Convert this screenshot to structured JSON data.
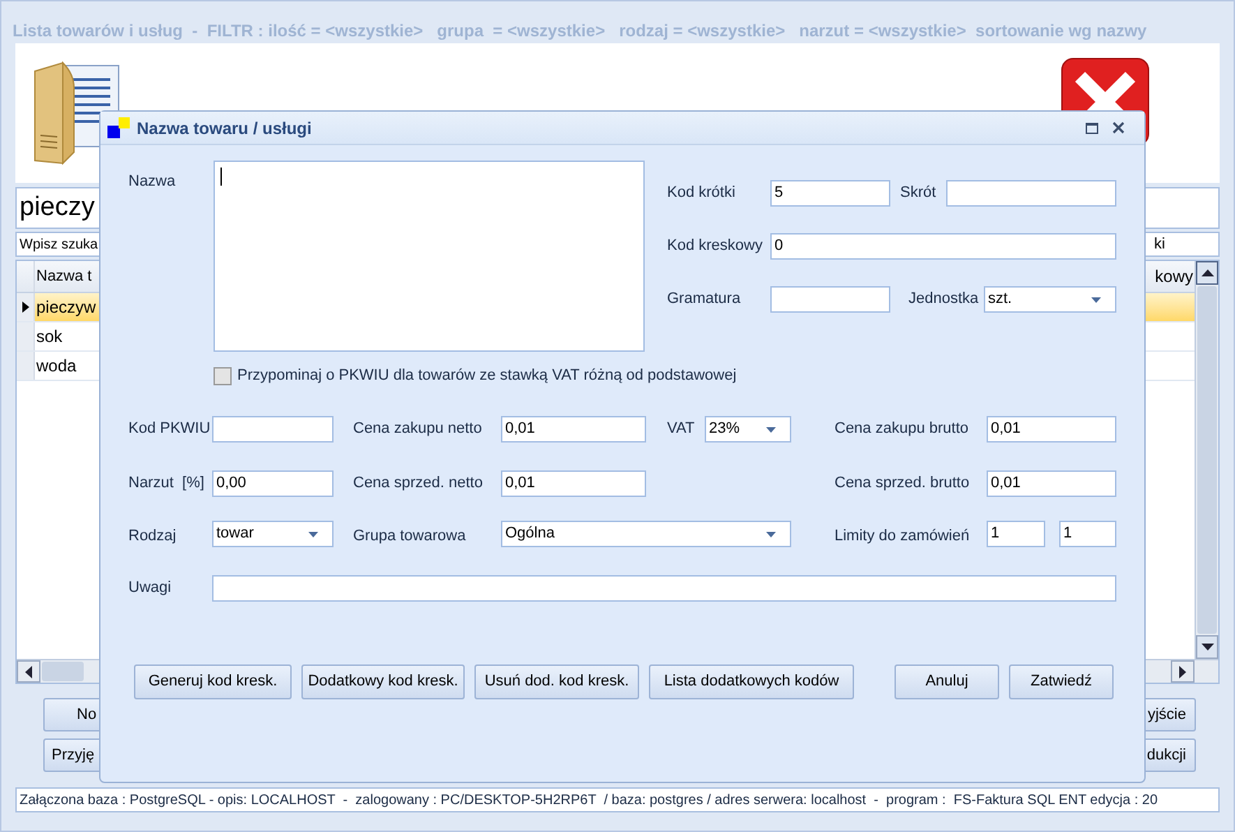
{
  "window": {
    "title": "Lista towarów i usług  -  FILTR : ilość = <wszystkie>   grupa  = <wszystkie>   rodzaj = <wszystkie>   narzut = <wszystkie>  sortowanie wg nazwy"
  },
  "search": {
    "value": "pieczy",
    "hint": "Wpisz szuka",
    "hint_right": "ki"
  },
  "table": {
    "columns": [
      "Nazwa t",
      "kowy"
    ],
    "rows": [
      {
        "name": "pieczyw",
        "selected": true
      },
      {
        "name": "sok",
        "selected": false
      },
      {
        "name": "woda",
        "selected": false
      }
    ]
  },
  "buttons_left": [
    "No",
    "Przyję"
  ],
  "buttons_right": [
    "yjście",
    "dukcji"
  ],
  "status_bar": "Załączona baza : PostgreSQL - opis: LOCALHOST  -  zalogowany : PC/DESKTOP-5H2RP6T  / baza: postgres / adres serwera: localhost  -  program :  FS-Faktura SQL ENT edycja : 20",
  "dialog": {
    "title": "Nazwa towaru / usługi",
    "name": {
      "label": "Nazwa"
    },
    "short_code": {
      "label": "Kod krótki",
      "value": "5"
    },
    "abbreviation": {
      "label": "Skrót"
    },
    "barcode": {
      "label": "Kod kreskowy",
      "value": "0"
    },
    "grammage": {
      "label": "Gramatura"
    },
    "unit": {
      "label": "Jednostka",
      "value": "szt."
    },
    "pkwiu_reminder": {
      "label": "Przypominaj o PKWIU dla towarów ze stawką VAT różną od podstawowej",
      "checked": false
    },
    "pkwiu": {
      "label": "Kod PKWIU"
    },
    "purchase_net": {
      "label": "Cena zakupu netto",
      "value": "0,01"
    },
    "vat": {
      "label": "VAT",
      "value": "23%"
    },
    "purchase_gross": {
      "label": "Cena zakupu brutto",
      "value": "0,01"
    },
    "markup": {
      "label": "Narzut  [%]",
      "value": "0,00"
    },
    "sale_net": {
      "label": "Cena sprzed. netto",
      "value": "0,01"
    },
    "sale_gross": {
      "label": "Cena sprzed. brutto",
      "value": "0,01"
    },
    "kind": {
      "label": "Rodzaj",
      "value": "towar"
    },
    "group": {
      "label": "Grupa towarowa",
      "value": "Ogólna"
    },
    "order_limits": {
      "label": "Limity do zamówień",
      "values": [
        "1",
        "1"
      ]
    },
    "notes": {
      "label": "Uwagi"
    },
    "buttons_left": [
      "Generuj kod kresk.",
      "Dodatkowy kod kresk.",
      "Usuń dod. kod kresk.",
      "Lista dodatkowych kodów"
    ],
    "buttons_right": [
      "Anuluj",
      "Zatwiedź"
    ]
  }
}
